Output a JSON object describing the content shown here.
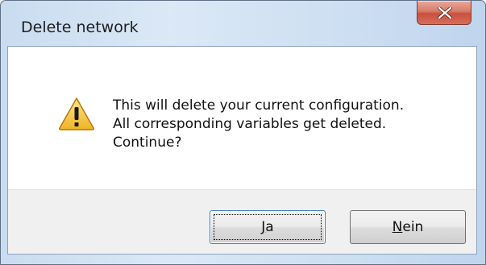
{
  "window": {
    "title": "Delete network"
  },
  "titlebar": {
    "close_icon": "close-icon"
  },
  "message": {
    "icon": "warning-icon",
    "lines": [
      "This will delete your current configuration.",
      "All corresponding variables get deleted.",
      "Continue?"
    ]
  },
  "buttons": {
    "yes": {
      "mnemonic": "J",
      "rest": "a",
      "label": "Ja",
      "default": true
    },
    "no": {
      "mnemonic": "N",
      "rest": "ein",
      "label": "Nein",
      "default": false
    }
  },
  "colors": {
    "close_button": "#c8503c",
    "warning_fill": "#f7c53a",
    "default_button_border": "#3c7fb1"
  }
}
